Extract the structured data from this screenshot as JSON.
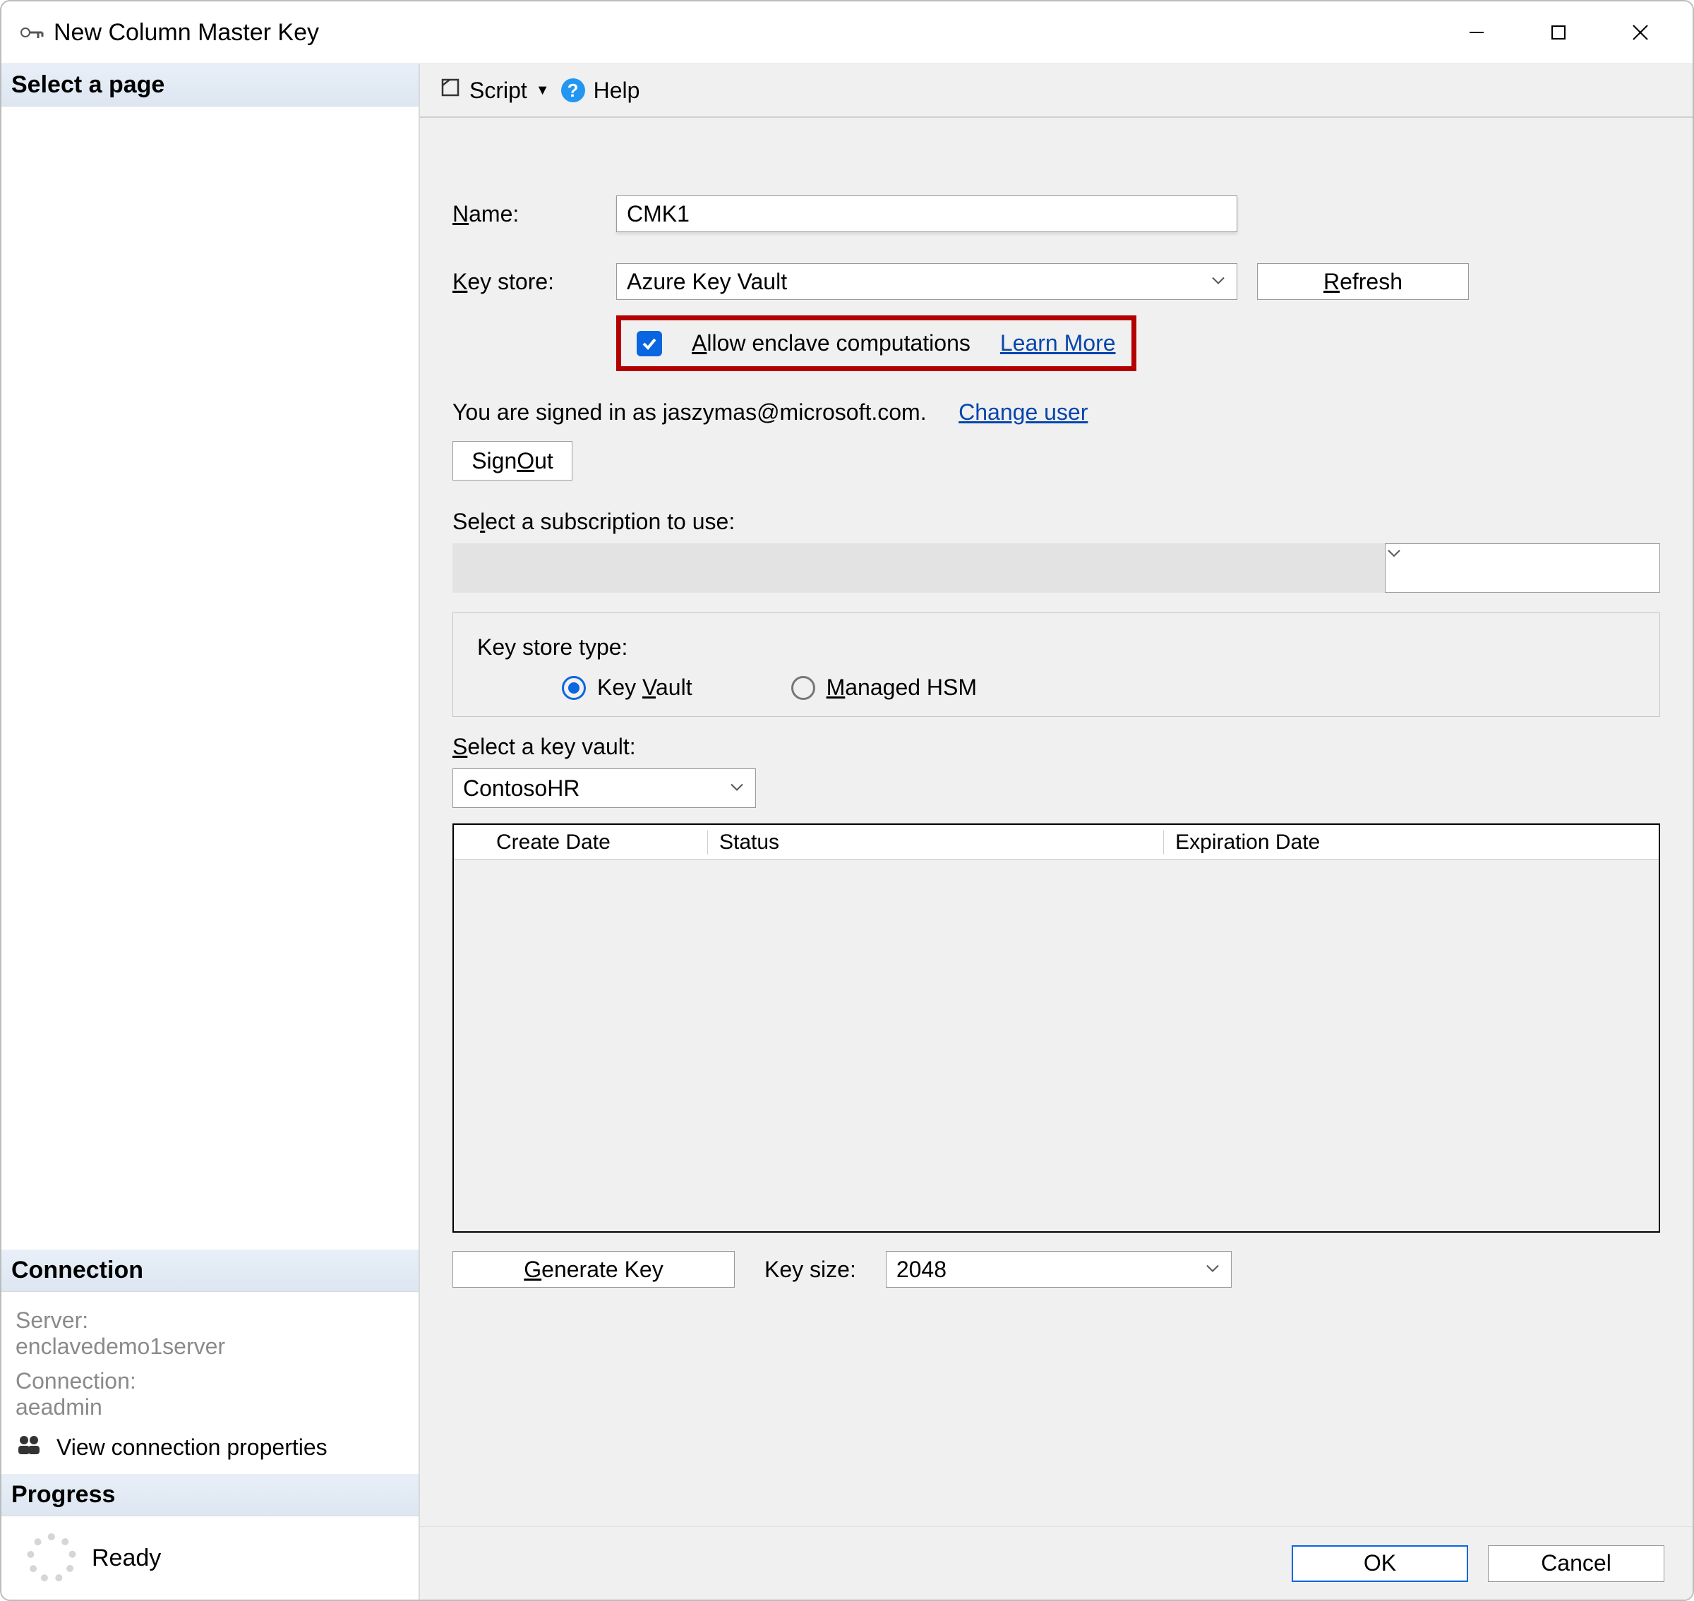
{
  "window": {
    "title": "New Column Master Key"
  },
  "sidebar": {
    "select_page": "Select a page",
    "connection_hdr": "Connection",
    "server_label": "Server:",
    "server_value": "enclavedemo1server",
    "connection_label": "Connection:",
    "connection_value": "aeadmin",
    "view_conn": "View connection properties",
    "progress_hdr": "Progress",
    "ready": "Ready"
  },
  "toolbar": {
    "script": "Script",
    "help": "Help"
  },
  "form": {
    "name_label": "Name:",
    "name_value": "CMK1",
    "keystore_label": "Key store:",
    "keystore_value": "Azure Key Vault",
    "refresh": "Refresh",
    "allow_enclave": "Allow enclave computations",
    "learn_more": "Learn More",
    "signed_in": "You are signed in as jaszymas@microsoft.com.",
    "change_user": "Change user",
    "sign_out": "Sign Out",
    "select_sub": "Select a subscription to use:",
    "keystore_type_legend": "Key store type:",
    "radio_key_vault": "Key Vault",
    "radio_mhsm": "Managed HSM",
    "select_key_vault_label": "Select a key vault:",
    "key_vault_value": "ContosoHR",
    "table_headers": {
      "create_date": "Create Date",
      "status": "Status",
      "expiration": "Expiration Date"
    },
    "generate_key": "Generate Key",
    "key_size_label": "Key size:",
    "key_size_value": "2048"
  },
  "footer": {
    "ok": "OK",
    "cancel": "Cancel"
  }
}
